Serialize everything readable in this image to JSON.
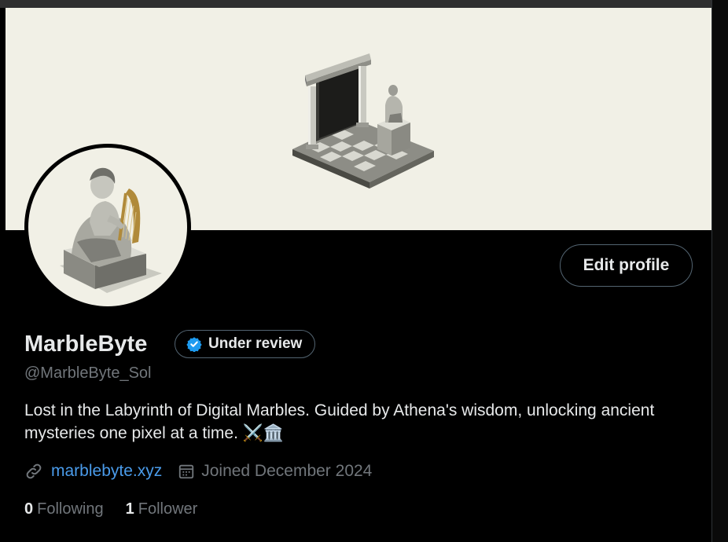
{
  "profile": {
    "display_name": "MarbleByte",
    "badge_label": "Under review",
    "handle": "@MarbleByte_Sol",
    "bio": "Lost in the Labyrinth of Digital Marbles. Guided by Athena's wisdom, unlocking ancient mysteries one pixel at a time. ⚔️🏛️",
    "website": "marblebyte.xyz",
    "joined": "Joined December 2024"
  },
  "actions": {
    "edit_profile_label": "Edit profile"
  },
  "stats": {
    "following_count": "0",
    "following_label": "Following",
    "followers_count": "1",
    "followers_label": "Follower"
  },
  "icons": {
    "badge": "verified-check-icon",
    "website": "link-icon",
    "joined": "calendar-icon"
  },
  "colors": {
    "background": "#000000",
    "banner": "#f1f0e6",
    "link": "#4a9bea",
    "muted_text": "#71767b",
    "verified": "#1d9bf0"
  }
}
